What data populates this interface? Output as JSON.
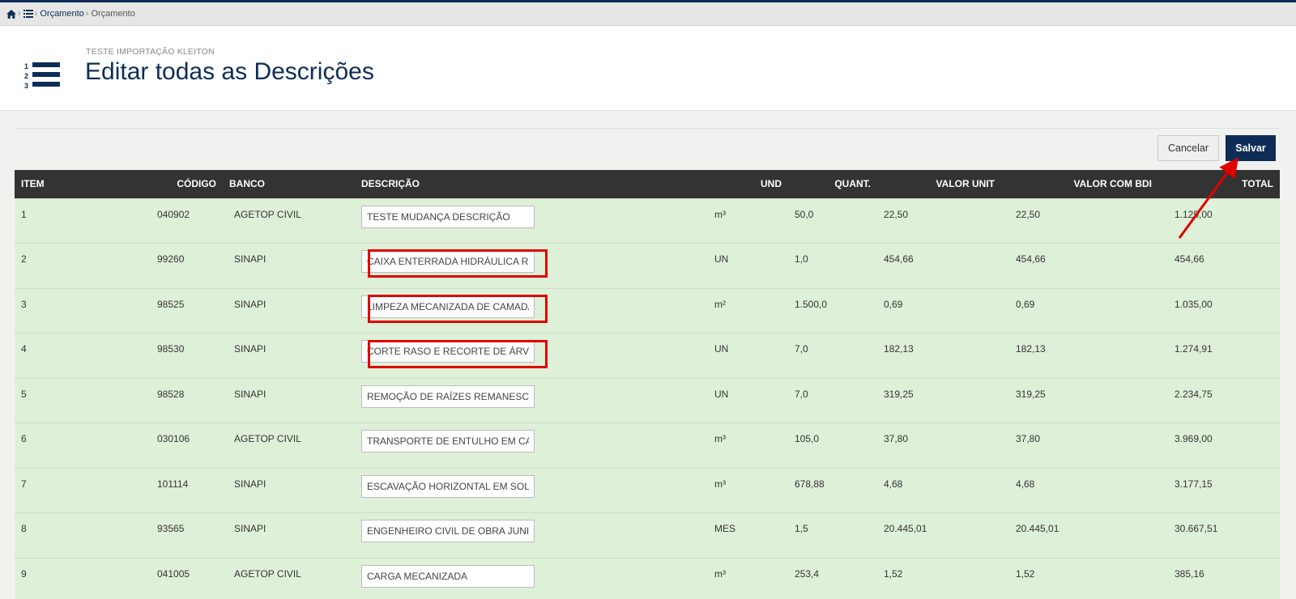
{
  "breadcrumb": {
    "item1": "Orçamento",
    "item2": "Orçamento"
  },
  "header": {
    "subtitle": "TESTE IMPORTAÇÃO KLEITON",
    "title": "Editar todas as Descrições"
  },
  "buttons": {
    "cancel": "Cancelar",
    "save": "Salvar"
  },
  "table": {
    "columns": [
      "ITEM",
      "CÓDIGO",
      "BANCO",
      "DESCRIÇÃO",
      "UND",
      "QUANT.",
      "VALOR UNIT",
      "VALOR COM BDI",
      "TOTAL"
    ],
    "rows": [
      {
        "item": "1",
        "codigo": "040902",
        "banco": "AGETOP CIVIL",
        "descricao": "TESTE MUDANÇA DESCRIÇÃO",
        "und": "m³",
        "quant": "50,0",
        "valor_unit": "22,50",
        "valor_bdi": "22,50",
        "total": "1.125,00"
      },
      {
        "item": "2",
        "codigo": "99260",
        "banco": "SINAPI",
        "descricao": "CAIXA ENTERRADA HIDRÁULICA RETANGULAR",
        "und": "UN",
        "quant": "1,0",
        "valor_unit": "454,66",
        "valor_bdi": "454,66",
        "total": "454,66"
      },
      {
        "item": "3",
        "codigo": "98525",
        "banco": "SINAPI",
        "descricao": "LIMPEZA MECANIZADA DE CAMADA VEGETAL",
        "und": "m²",
        "quant": "1.500,0",
        "valor_unit": "0,69",
        "valor_bdi": "0,69",
        "total": "1.035,00"
      },
      {
        "item": "4",
        "codigo": "98530",
        "banco": "SINAPI",
        "descricao": "CORTE RASO E RECORTE DE ÁRVORE",
        "und": "UN",
        "quant": "7,0",
        "valor_unit": "182,13",
        "valor_bdi": "182,13",
        "total": "1.274,91"
      },
      {
        "item": "5",
        "codigo": "98528",
        "banco": "SINAPI",
        "descricao": "REMOÇÃO DE RAÍZES REMANESCENTES",
        "und": "UN",
        "quant": "7,0",
        "valor_unit": "319,25",
        "valor_bdi": "319,25",
        "total": "2.234,75"
      },
      {
        "item": "6",
        "codigo": "030106",
        "banco": "AGETOP CIVIL",
        "descricao": "TRANSPORTE DE ENTULHO EM CAMINHÃO",
        "und": "m³",
        "quant": "105,0",
        "valor_unit": "37,80",
        "valor_bdi": "37,80",
        "total": "3.969,00"
      },
      {
        "item": "7",
        "codigo": "101114",
        "banco": "SINAPI",
        "descricao": "ESCAVAÇÃO HORIZONTAL EM SOLO",
        "und": "m³",
        "quant": "678,88",
        "valor_unit": "4,68",
        "valor_bdi": "4,68",
        "total": "3.177,15"
      },
      {
        "item": "8",
        "codigo": "93565",
        "banco": "SINAPI",
        "descricao": "ENGENHEIRO CIVIL DE OBRA JUNIOR",
        "und": "MES",
        "quant": "1,5",
        "valor_unit": "20.445,01",
        "valor_bdi": "20.445,01",
        "total": "30.667,51"
      },
      {
        "item": "9",
        "codigo": "041005",
        "banco": "AGETOP CIVIL",
        "descricao": "CARGA MECANIZADA",
        "und": "m³",
        "quant": "253,4",
        "valor_unit": "1,52",
        "valor_bdi": "1,52",
        "total": "385,16"
      }
    ]
  },
  "colors": {
    "navy": "#0d2d57",
    "row_bg": "#dff0d8",
    "header_bg": "#333333",
    "highlight": "#e00000"
  }
}
